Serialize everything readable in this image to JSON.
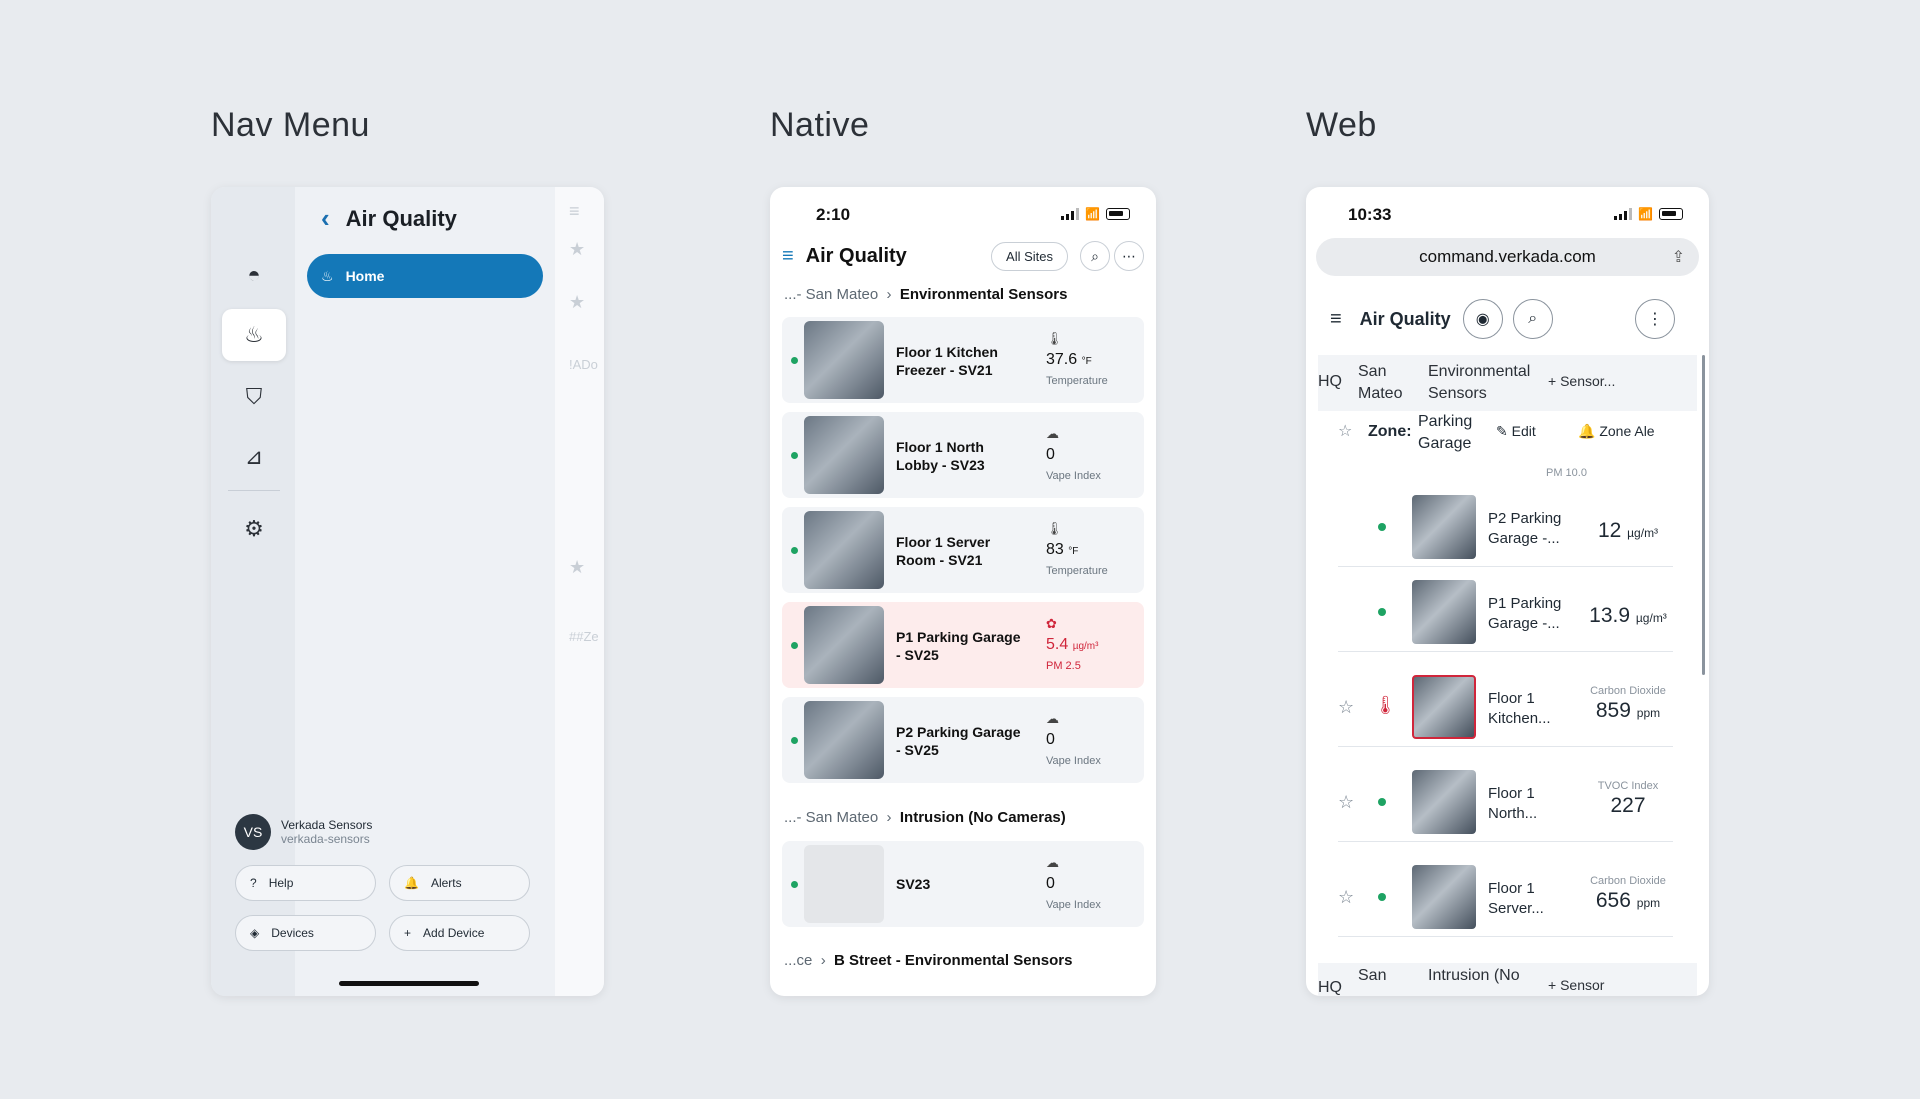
{
  "sections": [
    "Nav Menu",
    "Native",
    "Web"
  ],
  "nav": {
    "title": "Air Quality",
    "home_label": "Home",
    "user_name": "Verkada Sensors",
    "user_sub": "verkada-sensors",
    "avatar": "VS",
    "buttons": {
      "help": "Help",
      "alerts": "Alerts",
      "devices": "Devices",
      "add_device": "Add Device"
    },
    "shade_text_1": "!ADo",
    "shade_text_2": "##Ze"
  },
  "native": {
    "time": "2:10",
    "title": "Air Quality",
    "chip": "All Sites",
    "crumb1_prefix": "...- San Mateo",
    "crumb1_bold": "Environmental Sensors",
    "crumb2_prefix": "...- San Mateo",
    "crumb2_bold": "Intrusion (No Cameras)",
    "crumb3_prefix": "...ce",
    "crumb3_bold": "B Street - Environmental Sensors",
    "cards": [
      {
        "name": "Floor 1 Kitchen Freezer - SV21",
        "value": "37.6",
        "unit": "°F",
        "label": "Temperature",
        "icon": "thermometer-icon"
      },
      {
        "name": "Floor 1 North Lobby - SV23",
        "value": "0",
        "unit": "",
        "label": "Vape Index",
        "icon": "vape-icon"
      },
      {
        "name": "Floor 1 Server Room - SV21",
        "value": "83",
        "unit": "°F",
        "label": "Temperature",
        "icon": "thermometer-icon"
      },
      {
        "name": "P1 Parking Garage - SV25",
        "value": "5.4",
        "unit": "µg/m³",
        "label": "PM 2.5",
        "icon": "particulate-icon"
      },
      {
        "name": "P2 Parking Garage - SV25",
        "value": "0",
        "unit": "",
        "label": "Vape Index",
        "icon": "vape-icon"
      },
      {
        "name": "SV23",
        "value": "0",
        "unit": "",
        "label": "Vape Index",
        "icon": "vape-icon"
      }
    ]
  },
  "web": {
    "time": "10:33",
    "url": "command.verkada.com",
    "title": "Air Quality",
    "crumb": {
      "hq": "HQ",
      "site": "San Mateo",
      "group": "Environmental Sensors",
      "action": "Sensor..."
    },
    "zone_label": "Zone:",
    "zone_name": "Parking Garage",
    "edit": "Edit",
    "zone_alert": "Zone Ale",
    "pm_label": "PM 10.0",
    "rows": [
      {
        "name": "P2 Parking Garage -...",
        "label": "",
        "value": "12",
        "unit": "µg/m³"
      },
      {
        "name": "P1 Parking Garage -...",
        "label": "",
        "value": "13.9",
        "unit": "µg/m³"
      },
      {
        "name": "Floor 1 Kitchen...",
        "label": "Carbon Dioxide",
        "value": "859",
        "unit": "ppm"
      },
      {
        "name": "Floor 1 North...",
        "label": "TVOC Index",
        "value": "227",
        "unit": ""
      },
      {
        "name": "Floor 1 Server...",
        "label": "Carbon Dioxide",
        "value": "656",
        "unit": "ppm"
      }
    ],
    "crumb2": {
      "hq": "HQ",
      "site": "San",
      "group": "Intrusion (No",
      "action": "Sensor"
    }
  }
}
